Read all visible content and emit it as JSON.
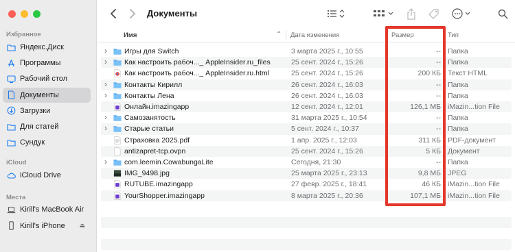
{
  "sidebar": {
    "favorites_label": "Избранное",
    "favorites": [
      {
        "label": "Яндекс.Диск",
        "icon": "folder-icon"
      },
      {
        "label": "Программы",
        "icon": "apps-icon"
      },
      {
        "label": "Рабочий стол",
        "icon": "desktop-icon"
      },
      {
        "label": "Документы",
        "icon": "document-icon",
        "active": true
      },
      {
        "label": "Загрузки",
        "icon": "download-icon"
      },
      {
        "label": "Для статей",
        "icon": "folder-icon"
      },
      {
        "label": "Сундук",
        "icon": "folder-icon"
      }
    ],
    "icloud_label": "iCloud",
    "icloud": [
      {
        "label": "iCloud Drive",
        "icon": "cloud-icon"
      }
    ],
    "places_label": "Места",
    "places": [
      {
        "label": "Kirill's MacBook Air",
        "icon": "laptop-icon"
      },
      {
        "label": "Kirill's iPhone",
        "icon": "iphone-icon"
      }
    ]
  },
  "toolbar": {
    "title": "Документы"
  },
  "columns": {
    "name": "Имя",
    "date": "Дата изменения",
    "size": "Размер",
    "type": "Тип"
  },
  "files": [
    {
      "name": "Игры для Switch",
      "date": "3 марта 2025 г., 10:55",
      "size": "--",
      "type": "Папка",
      "kind": "folder",
      "expandable": true
    },
    {
      "name": "Как настроить рабоч..._ AppleInsider.ru_files",
      "date": "25 сент. 2024 г., 15:26",
      "size": "--",
      "type": "Папка",
      "kind": "folder",
      "expandable": true
    },
    {
      "name": "Как настроить рабоч..._ AppleInsider.ru.html",
      "date": "25 сент. 2024 г., 15:26",
      "size": "200 КБ",
      "type": "Текст HTML",
      "kind": "html",
      "expandable": false
    },
    {
      "name": "Контакты Кирилл",
      "date": "26 сент. 2024 г., 16:03",
      "size": "--",
      "type": "Папка",
      "kind": "folder",
      "expandable": true
    },
    {
      "name": "Контакты Лена",
      "date": "26 сент. 2024 г., 16:03",
      "size": "--",
      "type": "Папка",
      "kind": "folder",
      "expandable": true
    },
    {
      "name": "Онлайн.imazingapp",
      "date": "12 сент. 2024 г., 12:01",
      "size": "126,1 МБ",
      "type": "iMazin...tion File",
      "kind": "imazing",
      "expandable": false
    },
    {
      "name": "Самозанятость",
      "date": "31 марта 2025 г., 10:54",
      "size": "--",
      "type": "Папка",
      "kind": "folder",
      "expandable": true
    },
    {
      "name": "Старые статьи",
      "date": "5 сент. 2024 г., 10:37",
      "size": "--",
      "type": "Папка",
      "kind": "folder",
      "expandable": true
    },
    {
      "name": "Страховка 2025.pdf",
      "date": "1 апр. 2025 г., 12:03",
      "size": "311 КБ",
      "type": "PDF-документ",
      "kind": "pdf",
      "expandable": false
    },
    {
      "name": "antizapret-tcp.ovpn",
      "date": "25 сент. 2024 г., 15:26",
      "size": "5 КБ",
      "type": "Документ",
      "kind": "doc",
      "expandable": false
    },
    {
      "name": "com.leemin.CowabungaLite",
      "date": "Сегодня, 21:30",
      "size": "--",
      "type": "Папка",
      "kind": "folder",
      "expandable": true
    },
    {
      "name": "IMG_9498.jpg",
      "date": "25 марта 2025 г., 23:13",
      "size": "9,8 МБ",
      "type": "JPEG",
      "kind": "image",
      "expandable": false
    },
    {
      "name": "RUTUBE.imazingapp",
      "date": "27 февр. 2025 г., 18:41",
      "size": "46 КБ",
      "type": "iMazin...tion File",
      "kind": "imazing",
      "expandable": false
    },
    {
      "name": "YourShopper.imazingapp",
      "date": "8 марта 2025 г., 20:36",
      "size": "107,1 МБ",
      "type": "iMazin...tion File",
      "kind": "imazing",
      "expandable": false
    }
  ],
  "colors": {
    "highlight": "#e3372a",
    "folder": "#5fb0f2",
    "accent": "#0a84ff"
  }
}
